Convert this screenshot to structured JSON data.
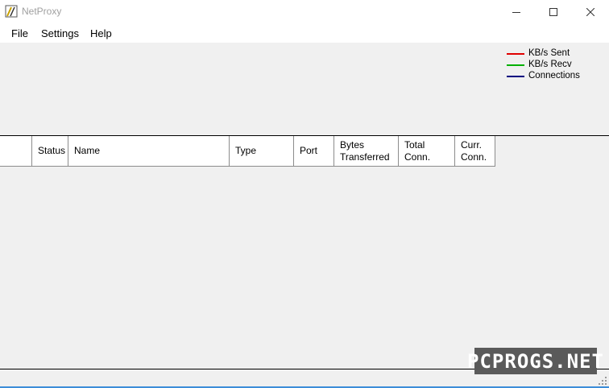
{
  "window": {
    "title": "NetProxy",
    "controls": {
      "minimize": "minimize-icon",
      "maximize": "maximize-icon",
      "close": "close-icon"
    }
  },
  "menu": {
    "items": [
      "File",
      "Settings",
      "Help"
    ]
  },
  "graph": {
    "legend": [
      {
        "label": "KB/s Sent",
        "color": "#e00000"
      },
      {
        "label": "KB/s Recv",
        "color": "#00b000"
      },
      {
        "label": "Connections",
        "color": "#000080"
      }
    ]
  },
  "table": {
    "columns": [
      "",
      "Status",
      "Name",
      "Type",
      "Port",
      "Bytes\nTransferred",
      "Total\nConn.",
      "Curr.\nConn."
    ],
    "rows": []
  },
  "watermark": "PCPROGS.NET",
  "colors": {
    "titlebar": "#ffffff",
    "background": "#f0f0f0",
    "statusbar_strip": "#3c8dd8"
  }
}
